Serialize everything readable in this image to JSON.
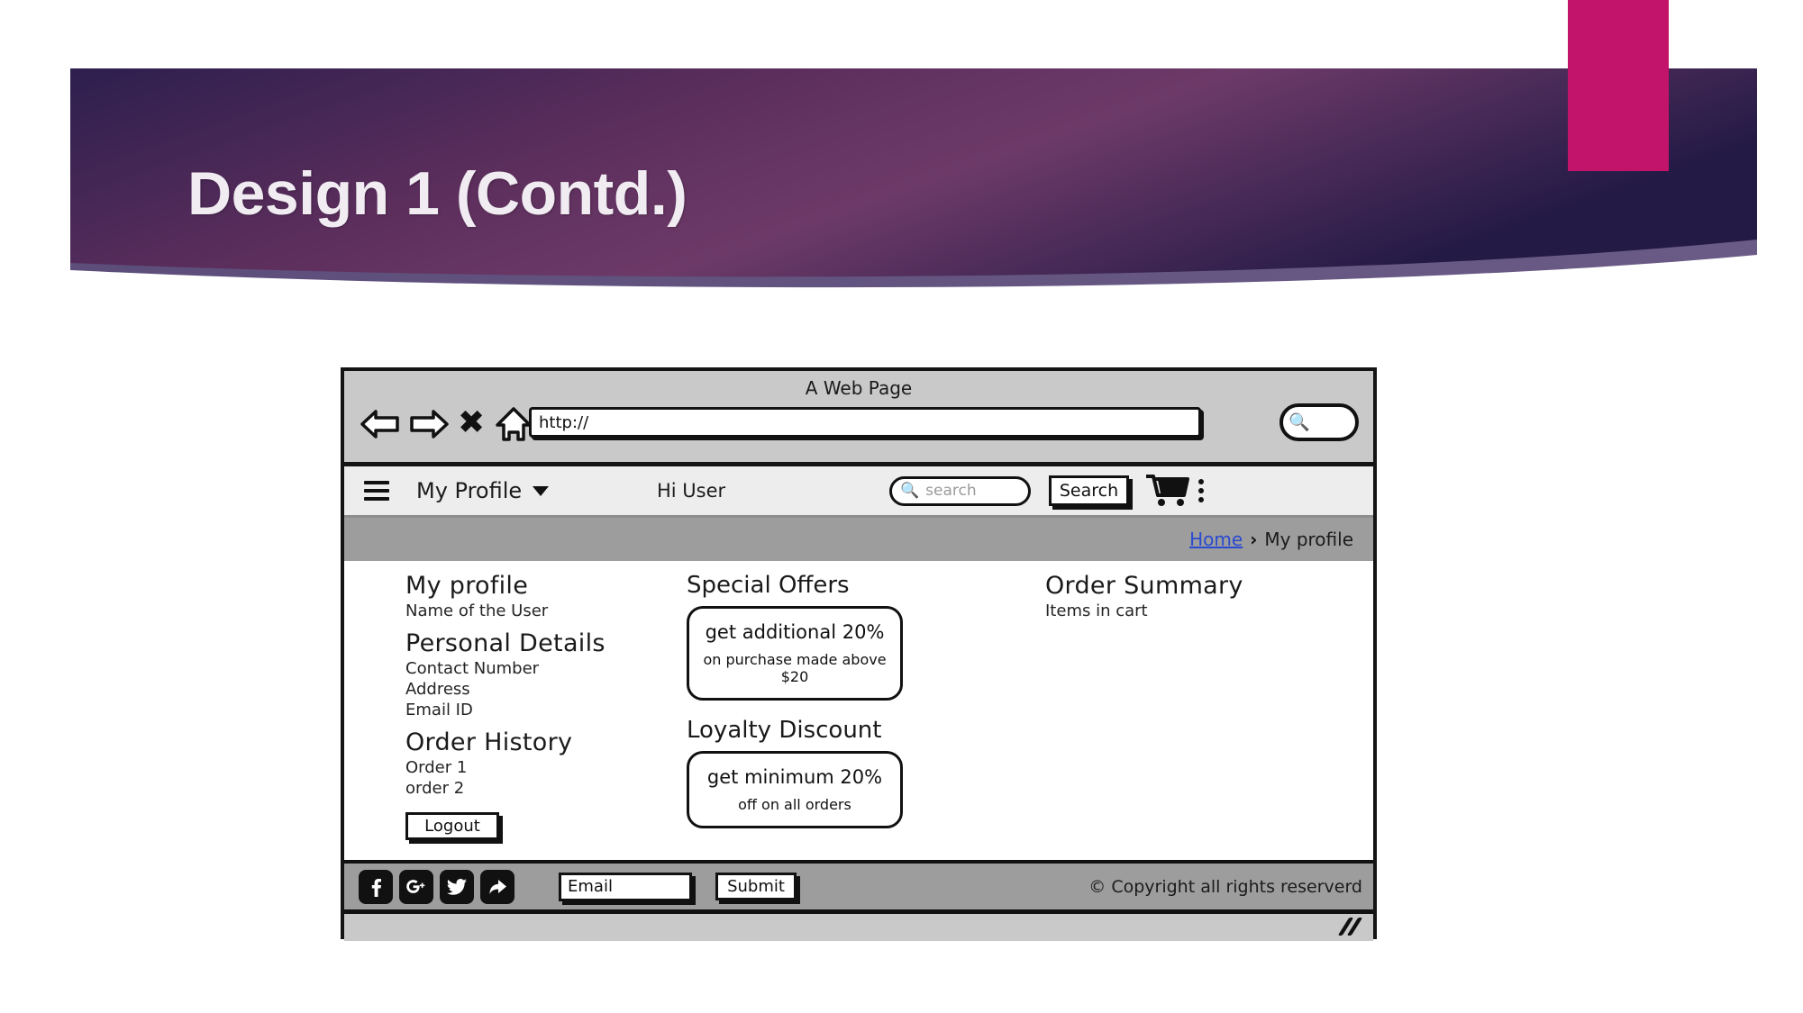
{
  "slide": {
    "title": "Design 1 (Contd.)",
    "accent_pink": "#c2146a",
    "banner_dark": "#241a46",
    "banner_light": "#6d3a68",
    "title_color": "#f0ecf2"
  },
  "browser": {
    "window_title": "A Web Page",
    "url_value": "http://",
    "back_icon": "back-arrow-icon",
    "forward_icon": "forward-arrow-icon",
    "stop_icon": "close-x-icon",
    "home_icon": "home-icon",
    "search_icon": "search-icon"
  },
  "site_nav": {
    "menu_icon": "hamburger-icon",
    "profile_label": "My Profile",
    "greeting": "Hi User",
    "search_placeholder": "search",
    "search_button": "Search",
    "cart_icon": "shopping-cart-icon",
    "overflow_icon": "kebab-menu-icon"
  },
  "breadcrumb": {
    "home": "Home",
    "separator": "›",
    "current": "My profile"
  },
  "profile": {
    "heading": "My profile",
    "name": "Name of the User",
    "details_heading": "Personal Details",
    "details": [
      "Contact Number",
      "Address",
      "Email ID"
    ],
    "history_heading": "Order History",
    "orders": [
      "Order 1",
      "order 2"
    ],
    "logout_label": "Logout"
  },
  "offers": {
    "special_heading": "Special Offers",
    "special_main": "get additional 20%",
    "special_sub": "on purchase made above $20",
    "loyalty_heading": "Loyalty Discount",
    "loyalty_main": "get minimum 20%",
    "loyalty_sub": "off on all orders"
  },
  "order_summary": {
    "heading": "Order Summary",
    "items_label": "Items in cart"
  },
  "footer": {
    "socials": [
      "facebook-icon",
      "google-plus-icon",
      "twitter-icon",
      "share-arrow-icon"
    ],
    "email_placeholder": "Email",
    "submit_label": "Submit",
    "copyright": "© Copyright all rights reserverd",
    "resize_icon": "resize-grip-icon"
  }
}
